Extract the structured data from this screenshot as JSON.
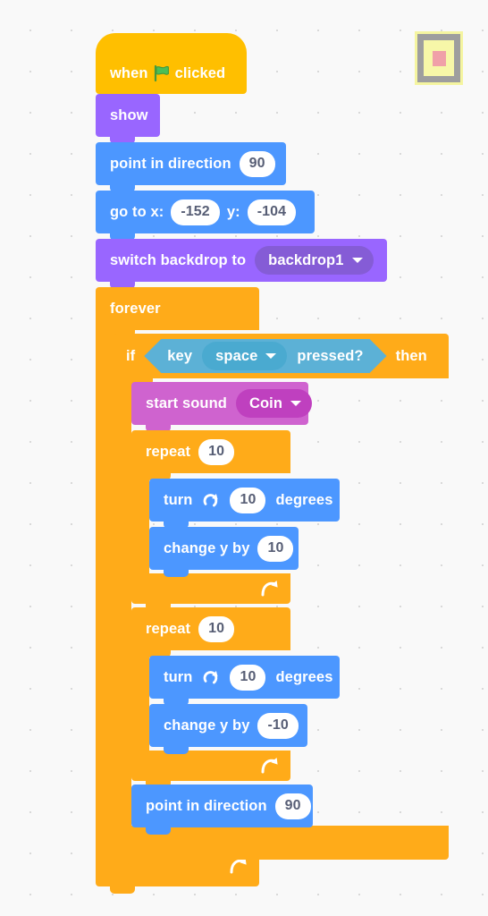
{
  "workspace": {
    "background_color": "#f9f9f9",
    "dot_color": "#d9d9d9"
  },
  "sprite_thumbnail": {
    "name": "sprite-thumbnail",
    "border_color": "#f5f5a0",
    "frame_color": "#9e9e9e",
    "inner_color": "#f7f7a8",
    "center_color": "#f0a0a8"
  },
  "palette": {
    "events": "#ffbf00",
    "looks": "#9966ff",
    "motion": "#4c97ff",
    "control": "#ffab19",
    "sound": "#cf63cf",
    "sensing": "#5cb1d6"
  },
  "script": {
    "hat": {
      "pre_label": "when",
      "icon": "green-flag-icon",
      "post_label": "clicked"
    },
    "show": {
      "label": "show"
    },
    "point_in_direction_1": {
      "label": "point in direction",
      "value": "90"
    },
    "go_to_xy": {
      "label_x": "go to x:",
      "value_x": "-152",
      "label_y": "y:",
      "value_y": "-104"
    },
    "switch_backdrop": {
      "label": "switch backdrop to",
      "value": "backdrop1"
    },
    "forever": {
      "label": "forever"
    },
    "if_then": {
      "label_if": "if",
      "label_then": "then",
      "condition": {
        "pre_label": "key",
        "value": "space",
        "post_label": "pressed?"
      }
    },
    "start_sound": {
      "label": "start sound",
      "value": "Coin"
    },
    "repeat_1": {
      "label": "repeat",
      "value": "10",
      "turn": {
        "label": "turn",
        "icon": "turn-clockwise-icon",
        "value": "10",
        "unit": "degrees"
      },
      "change_y": {
        "label": "change y by",
        "value": "10"
      }
    },
    "repeat_2": {
      "label": "repeat",
      "value": "10",
      "turn": {
        "label": "turn",
        "icon": "turn-clockwise-icon",
        "value": "10",
        "unit": "degrees"
      },
      "change_y": {
        "label": "change y by",
        "value": "-10"
      }
    },
    "point_in_direction_2": {
      "label": "point in direction",
      "value": "90"
    }
  }
}
